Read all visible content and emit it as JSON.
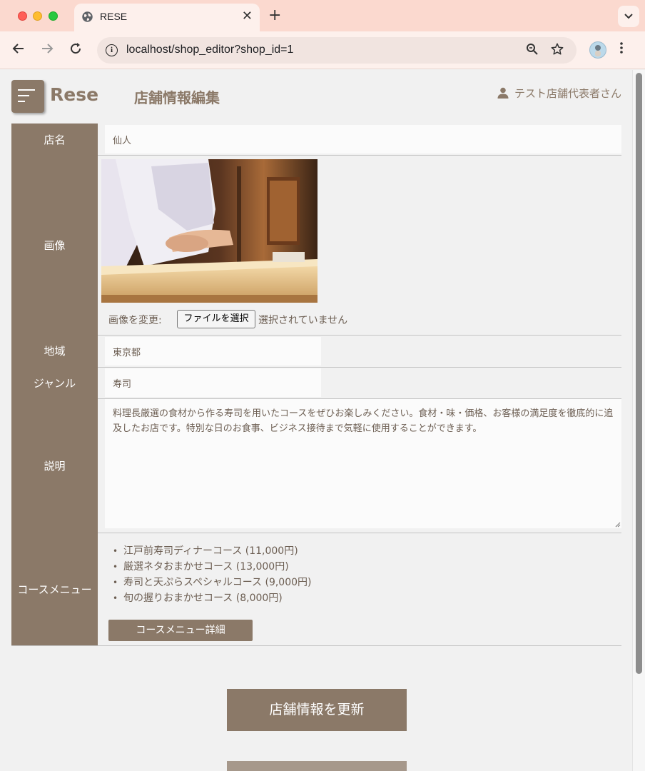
{
  "browser": {
    "tab_title": "RESE",
    "tab_close_glyph": "✕",
    "new_tab_glyph": "+",
    "url_host": "localhost",
    "url_path": "/shop_editor?shop_id=1",
    "icons": [
      "globe-icon",
      "back-icon",
      "forward-icon",
      "reload-icon",
      "info-icon",
      "zoom-icon",
      "star-icon",
      "profile-avatar",
      "menu-icon",
      "tab-list-icon"
    ]
  },
  "header": {
    "logo": "Rese",
    "page_title": "店舗情報編集",
    "user_name": "テスト店舗代表者さん"
  },
  "form": {
    "labels": {
      "name": "店名",
      "image": "画像",
      "area": "地域",
      "genre": "ジャンル",
      "description": "説明",
      "course_menu": "コースメニュー"
    },
    "values": {
      "name": "仙人",
      "area": "東京都",
      "genre": "寿司",
      "description": "料理長厳選の食材から作る寿司を用いたコースをぜひお楽しみください。食材・味・価格、お客様の満足度を徹底的に追及したお店です。特別な日のお食事、ビジネス接待まで気軽に使用することができます。"
    },
    "image_change_label": "画像を変更:",
    "file_button": "ファイルを選択",
    "file_status": "選択されていません",
    "courses": [
      "江戸前寿司ディナーコース (11,000円)",
      "厳選ネタおまかせコース (13,000円)",
      "寿司と天ぷらスペシャルコース (9,000円)",
      "旬の握りおまかせコース (8,000円)"
    ],
    "course_detail_button": "コースメニュー詳細"
  },
  "actions": {
    "update_button": "店舗情報を更新"
  },
  "colors": {
    "brand": "#8b7968",
    "tabbar": "#fbd9cf",
    "toolbar": "#fdf0ec",
    "page_bg": "#f1f1f1"
  }
}
